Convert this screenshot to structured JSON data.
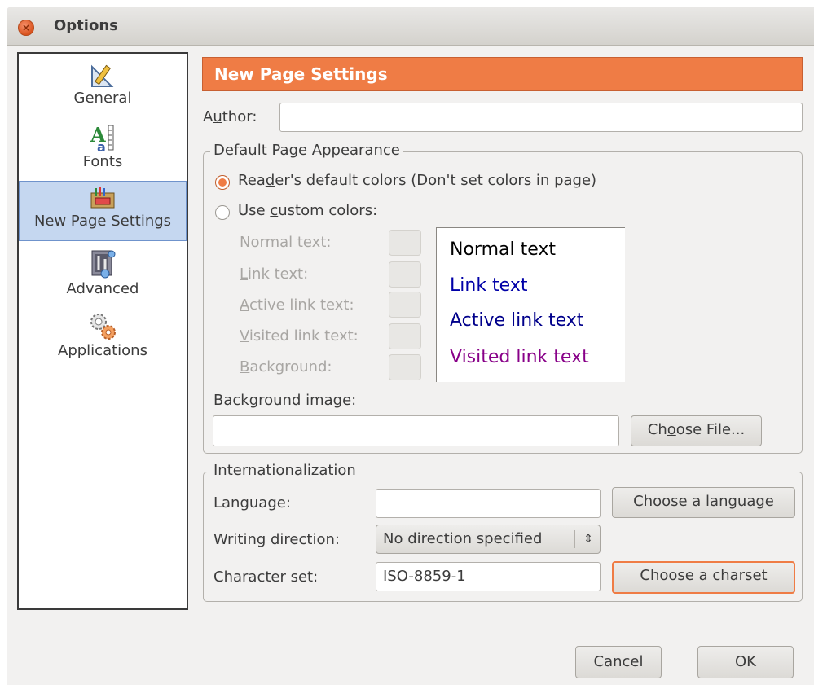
{
  "window": {
    "title": "Options"
  },
  "sidebar": {
    "items": [
      {
        "label": "General",
        "icon": "pencil-ruler-icon"
      },
      {
        "label": "Fonts",
        "icon": "fonts-icon"
      },
      {
        "label": "New Page Settings",
        "icon": "paint-box-icon",
        "selected": true
      },
      {
        "label": "Advanced",
        "icon": "advanced-icon"
      },
      {
        "label": "Applications",
        "icon": "gears-icon"
      }
    ]
  },
  "banner": {
    "title": "New Page Settings"
  },
  "author": {
    "label_pre": "A",
    "label_u": "u",
    "label_post": "thor:",
    "value": ""
  },
  "appearance": {
    "frame_title": "Default Page Appearance",
    "radio_default": {
      "pre": "Rea",
      "u": "d",
      "post": "er's default colors (Don't set colors in page)",
      "checked": true
    },
    "radio_custom": {
      "pre": "Use ",
      "u": "c",
      "post": "ustom colors:",
      "checked": false
    },
    "color_rows": [
      {
        "u": "N",
        "rest": "ormal text:"
      },
      {
        "u": "L",
        "rest": "ink text:"
      },
      {
        "u": "A",
        "rest": "ctive link text:"
      },
      {
        "u": "V",
        "rest": "isited link text:"
      },
      {
        "u": "B",
        "rest": "ackground:"
      }
    ],
    "preview": {
      "normal": "Normal text",
      "link": "Link text",
      "active": "Active link text",
      "visited": "Visited link text",
      "colors": {
        "normal": "#000000",
        "link": "#0000a8",
        "active": "#00008b",
        "visited": "#880088"
      }
    },
    "bg_image_label": {
      "pre": "Background i",
      "u": "m",
      "post": "age:"
    },
    "bg_image_value": "",
    "choose_file": {
      "pre": "Ch",
      "u": "o",
      "post": "ose File..."
    }
  },
  "i18n": {
    "frame_title": "Internationalization",
    "language_label": "Language:",
    "language_value": "",
    "choose_language": "Choose a language",
    "direction_label": "Writing direction:",
    "direction_value": "No direction specified",
    "charset_label": "Character set:",
    "charset_value": "ISO-8859-1",
    "choose_charset": "Choose a charset"
  },
  "footer": {
    "cancel": "Cancel",
    "ok": "OK"
  },
  "theme": {
    "accent": "#ef7c45",
    "selection": "#c5d7f0"
  }
}
